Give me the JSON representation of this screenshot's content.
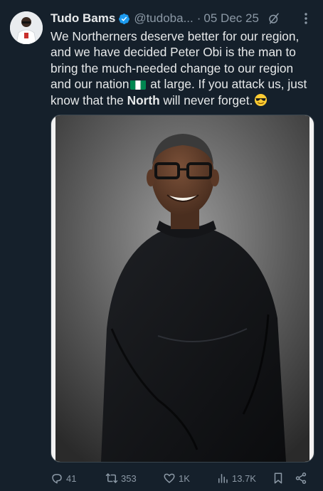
{
  "tweet": {
    "author_name": "Tudo Bams",
    "handle": "@tudoba...",
    "separator": "·",
    "date": "05 Dec 25",
    "text_part1": "We Northerners deserve better for our region, and we have decided Peter Obi is the man to bring the much-needed change to our region and our nation",
    "text_part2": " at large. If you attack us, just know that the ",
    "text_bold": "North",
    "text_part3": " will never forget.",
    "flag_icon": "nigeria-flag-icon",
    "emoji_icon": "sunglasses-emoji-icon"
  },
  "media": {
    "description_icon": "photo-of-man-in-black-kaftan"
  },
  "actions": {
    "replies": "41",
    "retweets": "353",
    "likes": "1K",
    "views": "13.7K"
  },
  "colors": {
    "background": "#15202b",
    "text": "#e7e9ea",
    "muted": "#8b98a5",
    "verified": "#1d9bf0"
  }
}
